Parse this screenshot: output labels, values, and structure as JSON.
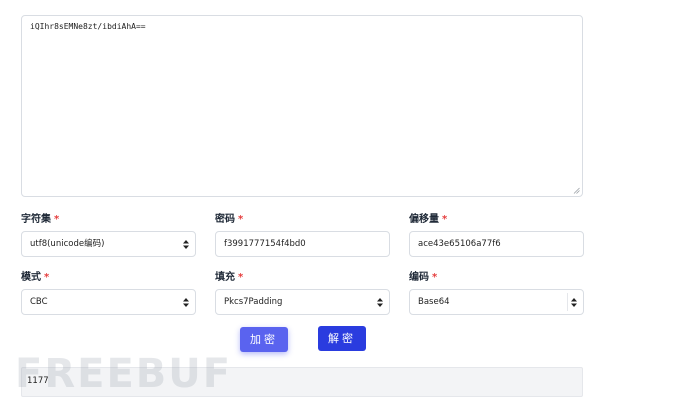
{
  "input": {
    "value": "iQIhr8sEMNe8zt/ibdiAhA=="
  },
  "fields": {
    "charset": {
      "label": "字符集",
      "required": "*",
      "value": "utf8(unicode编码)"
    },
    "key": {
      "label": "密码",
      "required": "*",
      "value": "f3991777154f4bd0"
    },
    "iv": {
      "label": "偏移量",
      "required": "*",
      "value": "ace43e65106a77f6"
    },
    "mode": {
      "label": "模式",
      "required": "*",
      "value": "CBC"
    },
    "padding": {
      "label": "填充",
      "required": "*",
      "value": "Pkcs7Padding"
    },
    "encoding": {
      "label": "编码",
      "required": "*",
      "value": "Base64"
    }
  },
  "buttons": {
    "encrypt": "加密",
    "decrypt": "解密"
  },
  "result": {
    "value": "1177"
  },
  "watermark": "FREEBUF",
  "colors": {
    "encrypt_button": "#5a63ef",
    "decrypt_button": "#2a3cdf",
    "required_star": "#e53e3e"
  }
}
